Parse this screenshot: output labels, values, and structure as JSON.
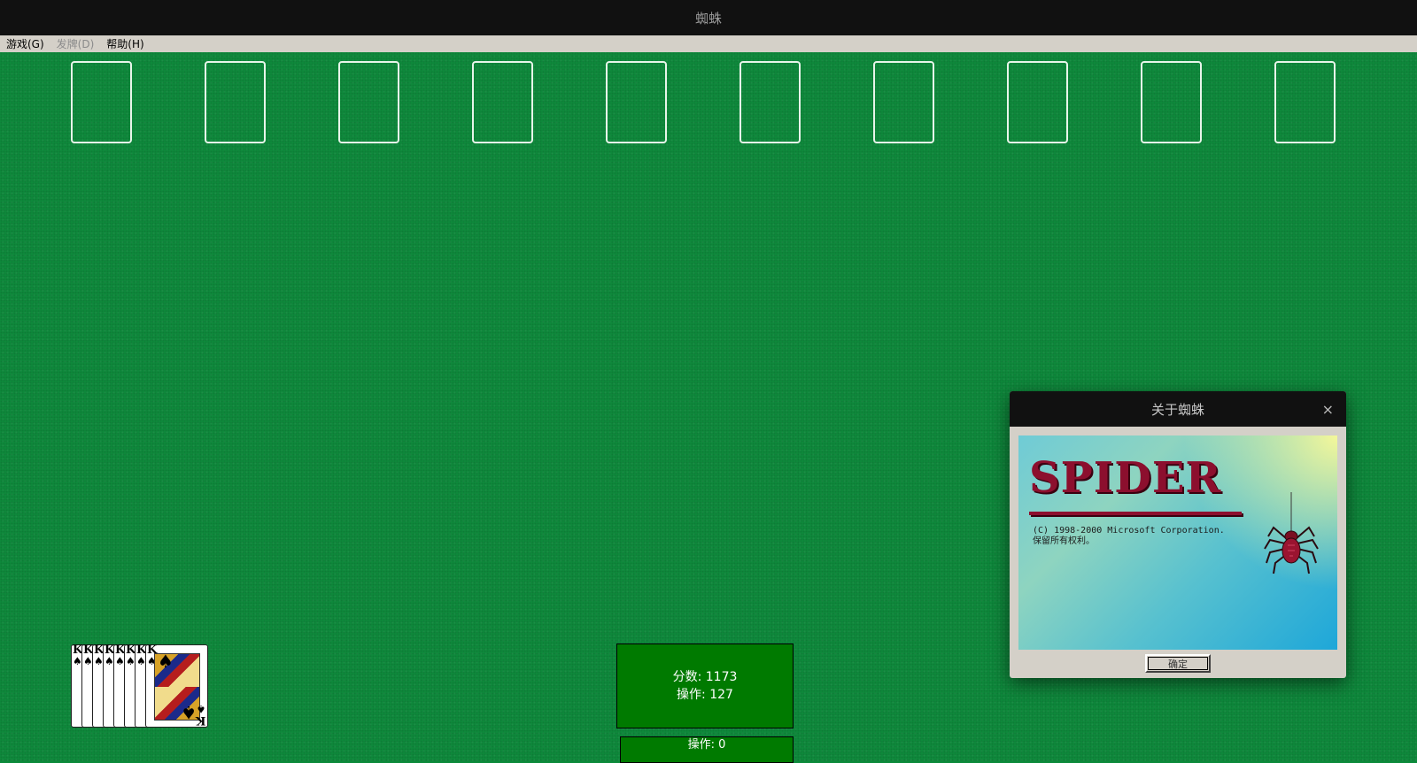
{
  "window": {
    "title": "蜘蛛"
  },
  "menu": [
    {
      "label": "游戏(G)",
      "enabled": true
    },
    {
      "label": "发牌(D)",
      "enabled": false
    },
    {
      "label": "帮助(H)",
      "enabled": true
    }
  ],
  "foundation": {
    "completed_rank": "K",
    "completed_suit": "♠",
    "completed_count": 8
  },
  "status": {
    "score_label": "分数:",
    "score_value": "1173",
    "moves_label": "操作:",
    "moves_value": "127",
    "hidden_moves_text": "操作: 0"
  },
  "about_dialog": {
    "title": "关于蜘蛛",
    "close_glyph": "×",
    "logo_text": "SPIDER",
    "copyright_line1": "(C) 1998-2000 Microsoft Corporation.",
    "copyright_line2": "保留所有权利。",
    "ok_label": "确定"
  },
  "colors": {
    "felt": "#0e8a3c",
    "status_bg": "#007a00",
    "logo": "#8c0f2e"
  }
}
